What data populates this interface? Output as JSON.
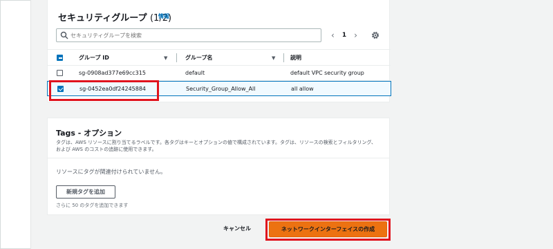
{
  "security_groups": {
    "title": "セキュリティグループ",
    "count": "(1/2)",
    "info_link": "情報",
    "search": {
      "placeholder": "セキュリティグループを検索",
      "value": ""
    },
    "pagination": {
      "prev_icon": "chevron-left-icon",
      "current_page": "1",
      "next_icon": "chevron-right-icon"
    },
    "settings_icon": "gear-icon",
    "columns": [
      {
        "label": "グループ ID",
        "sortable": true
      },
      {
        "label": "グループ名",
        "sortable": true
      },
      {
        "label": "説明",
        "sortable": false
      }
    ],
    "select_all_state": "indeterminate",
    "rows": [
      {
        "id": "sg-0908ad377e69cc315",
        "name": "default",
        "description": "default VPC security group",
        "checked": false
      },
      {
        "id": "sg-0452ea0df24245884",
        "name": "Security_Group_Allow_All",
        "description": "all allow",
        "checked": true
      }
    ]
  },
  "tags": {
    "title": "Tags - オプション",
    "description": "タグは、AWS リソースに割り当てるラベルです。各タグはキーとオプションの値で構成されています。タグは、リソースの検索とフィルタリング、および AWS のコストの追跡に使用できます。",
    "empty_message": "リソースにタグが関連付けられていません。",
    "add_button_label": "新規タグを追加",
    "limit_text": "さらに 50 のタグを追加できます"
  },
  "footer": {
    "cancel_label": "キャンセル",
    "create_label": "ネットワークインターフェイスの作成"
  },
  "colors": {
    "accent": "#0073bb",
    "primary_button": "#ec7211",
    "highlight_box": "#e0141e"
  }
}
